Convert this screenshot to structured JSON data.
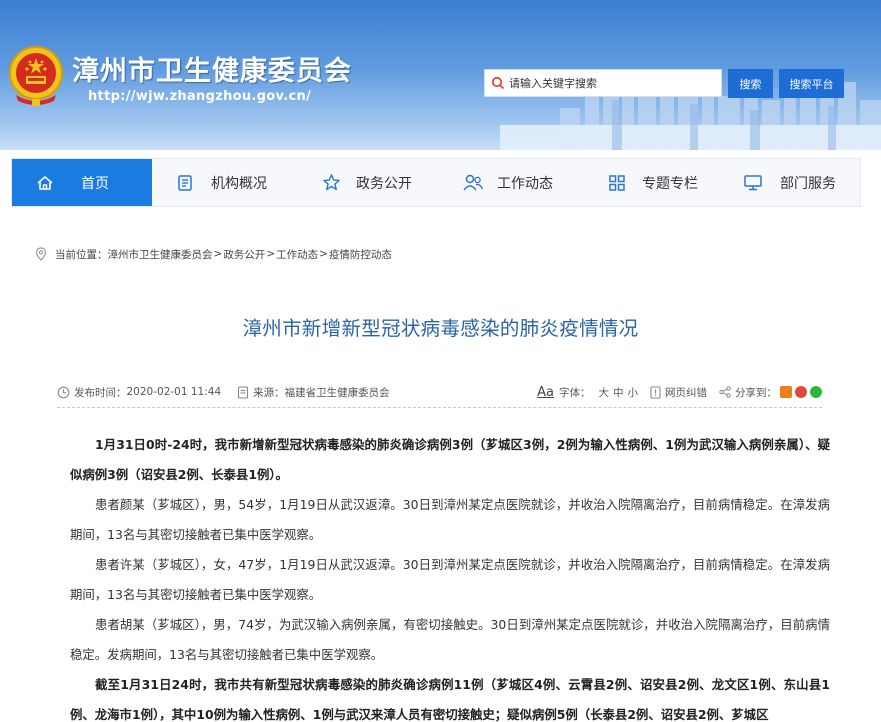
{
  "header": {
    "site_title": "漳州市卫生健康委员会",
    "site_url": "http://wjw.zhangzhou.gov.cn/",
    "search_placeholder": "请输入关键字搜索",
    "search_button": "搜索",
    "platform_button": "搜索平台"
  },
  "nav": {
    "items": [
      {
        "label": "首页",
        "icon": "home-icon",
        "active": true
      },
      {
        "label": "机构概况",
        "icon": "document-list-icon"
      },
      {
        "label": "政务公开",
        "icon": "star-icon"
      },
      {
        "label": "工作动态",
        "icon": "people-icon"
      },
      {
        "label": "专题专栏",
        "icon": "grid-icon"
      },
      {
        "label": "部门服务",
        "icon": "monitor-icon"
      }
    ]
  },
  "breadcrumb": {
    "prefix": "当前位置：",
    "items": [
      "漳州市卫生健康委员会",
      "政务公开",
      "工作动态",
      "疫情防控动态"
    ],
    "separator": ">"
  },
  "article": {
    "title": "漳州市新增新型冠状病毒感染的肺炎疫情情况",
    "publish_label": "发布时间：",
    "publish_time": "2020-02-01 11:44",
    "source_label": "来源：",
    "source": "福建省卫生健康委员会",
    "font_label": "字体：",
    "font_sizes": [
      "大",
      "中",
      "小"
    ],
    "error_label": "网页纠错",
    "share_label": "分享到：",
    "paragraphs": [
      {
        "text": "1月31日0时-24时，我市新增新型冠状病毒感染的肺炎确诊病例3例（芗城区3例，2例为输入性病例、1例为武汉输入病例亲属）、疑似病例3例（诏安县2例、长泰县1例）。",
        "strong": true
      },
      {
        "text": "患者颜某（芗城区），男，54岁，1月19日从武汉返漳。30日到漳州某定点医院就诊，并收治入院隔离治疗，目前病情稳定。在漳发病期间，13名与其密切接触者已集中医学观察。",
        "strong": false
      },
      {
        "text": "患者许某（芗城区），女，47岁，1月19日从武汉返漳。30日到漳州某定点医院就诊，并收治入院隔离治疗，目前病情稳定。在漳发病期间，13名与其密切接触者已集中医学观察。",
        "strong": false
      },
      {
        "text": "患者胡某（芗城区），男，74岁，为武汉输入病例亲属，有密切接触史。30日到漳州某定点医院就诊，并收治入院隔离治疗，目前病情稳定。发病期间，13名与其密切接触者已集中医学观察。",
        "strong": false
      },
      {
        "text": "截至1月31日24时，我市共有新型冠状病毒感染的肺炎确诊病例11例（芗城区4例、云霄县2例、诏安县2例、龙文区1例、东山县1例、龙海市1例），其中10例为输入性病例、1例与武汉来漳人员有密切接触史；疑似病例5例（长泰县2例、诏安县2例、芗城区",
        "strong": true
      }
    ]
  },
  "colors": {
    "nav_active": "#1a7be0",
    "title": "#2b63a8",
    "button": "#1e6dd4"
  }
}
